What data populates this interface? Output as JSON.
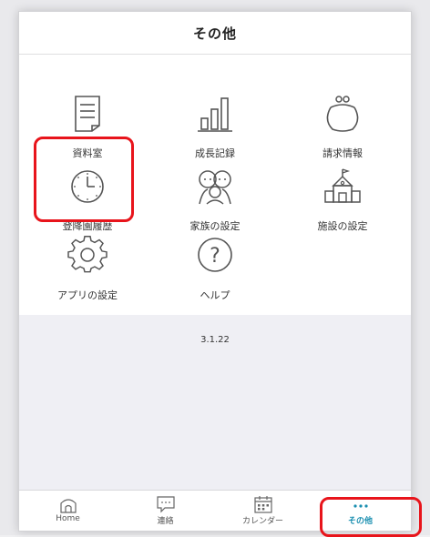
{
  "header": {
    "title": "その他"
  },
  "menu": {
    "items": [
      {
        "label": "資料室",
        "icon": "document-icon"
      },
      {
        "label": "成長記録",
        "icon": "bar-chart-icon"
      },
      {
        "label": "請求情報",
        "icon": "coin-purse-icon"
      },
      {
        "label": "登降園履歴",
        "icon": "clock-icon"
      },
      {
        "label": "家族の設定",
        "icon": "family-icon"
      },
      {
        "label": "施設の設定",
        "icon": "building-icon"
      },
      {
        "label": "アプリの設定",
        "icon": "gear-icon"
      },
      {
        "label": "ヘルプ",
        "icon": "help-icon"
      }
    ]
  },
  "version": "3.1.22",
  "tabbar": {
    "tabs": [
      {
        "label": "Home",
        "icon": "home-icon"
      },
      {
        "label": "連絡",
        "icon": "message-icon"
      },
      {
        "label": "カレンダー",
        "icon": "calendar-icon"
      },
      {
        "label": "その他",
        "icon": "more-icon",
        "active": true
      }
    ]
  },
  "colors": {
    "accent": "#1a8fb0",
    "highlight": "#e8141b",
    "icon_stroke": "#555555"
  }
}
